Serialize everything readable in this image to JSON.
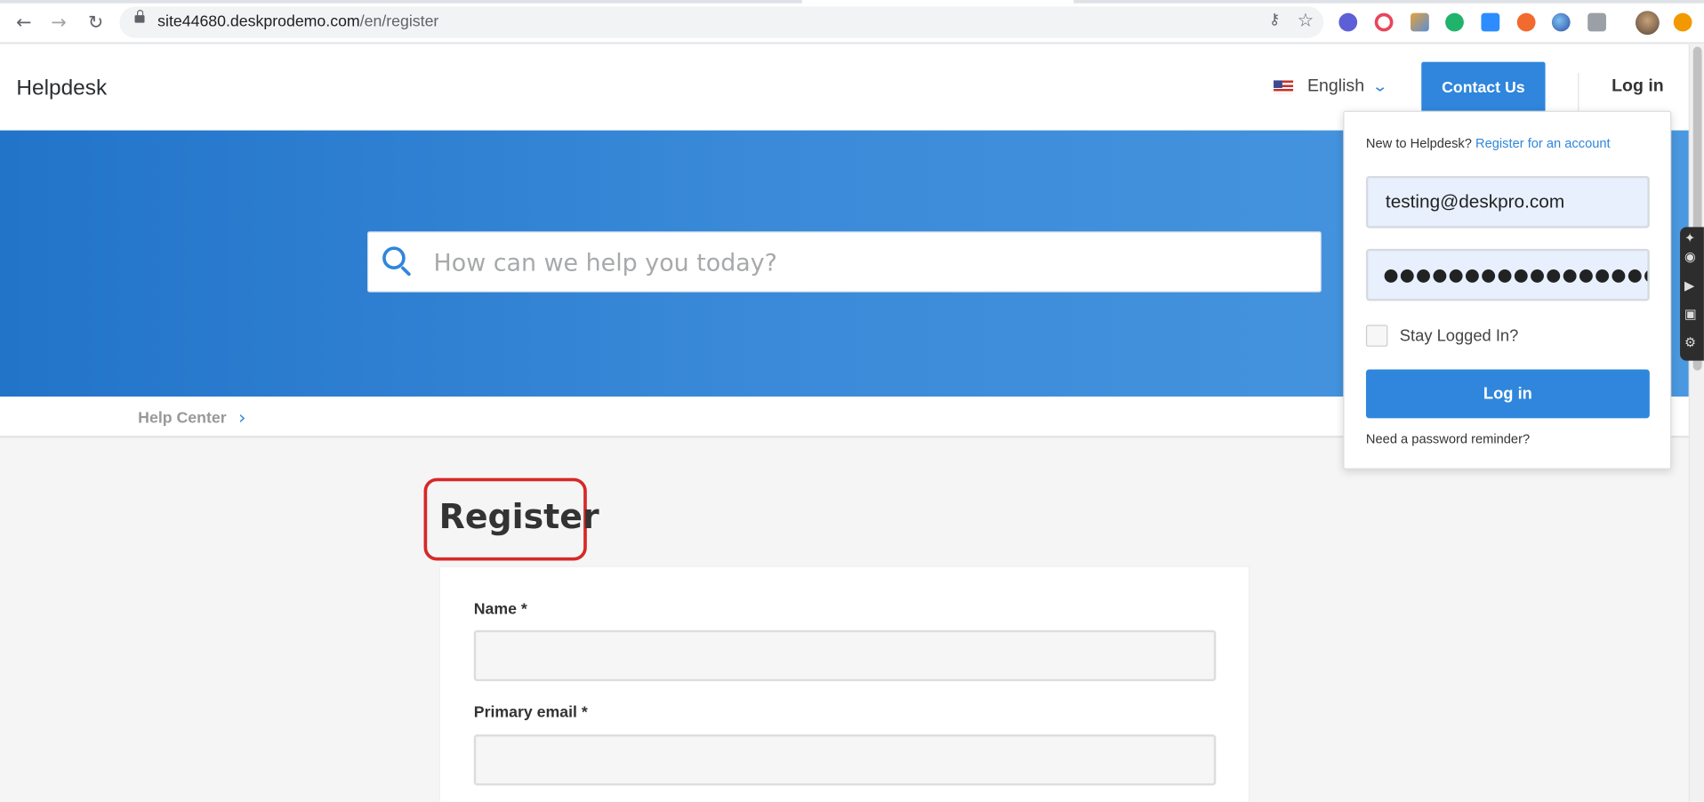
{
  "browser": {
    "url_host": "site44680.deskprodemo.com",
    "url_path": "/en/register"
  },
  "header": {
    "brand": "Helpdesk",
    "language": "English",
    "contact_label": "Contact Us",
    "login_label": "Log in"
  },
  "hero": {
    "search_placeholder": "How can we help you today?"
  },
  "breadcrumb": {
    "item": "Help Center"
  },
  "main": {
    "title": "Register",
    "fields": {
      "name_label": "Name *",
      "email_label": "Primary email *"
    }
  },
  "login_popover": {
    "new_text": "New to Helpdesk?",
    "register_link": "Register for an account",
    "email_value": "testing@deskpro.com",
    "password_masked": "●●●●●●●●●●●●●●●●●●●●●",
    "stay_logged_in": "Stay Logged In?",
    "login_button": "Log in",
    "reminder": "Need a password reminder?"
  },
  "colors": {
    "accent": "#2f86dc",
    "highlight_box": "#d62828"
  }
}
